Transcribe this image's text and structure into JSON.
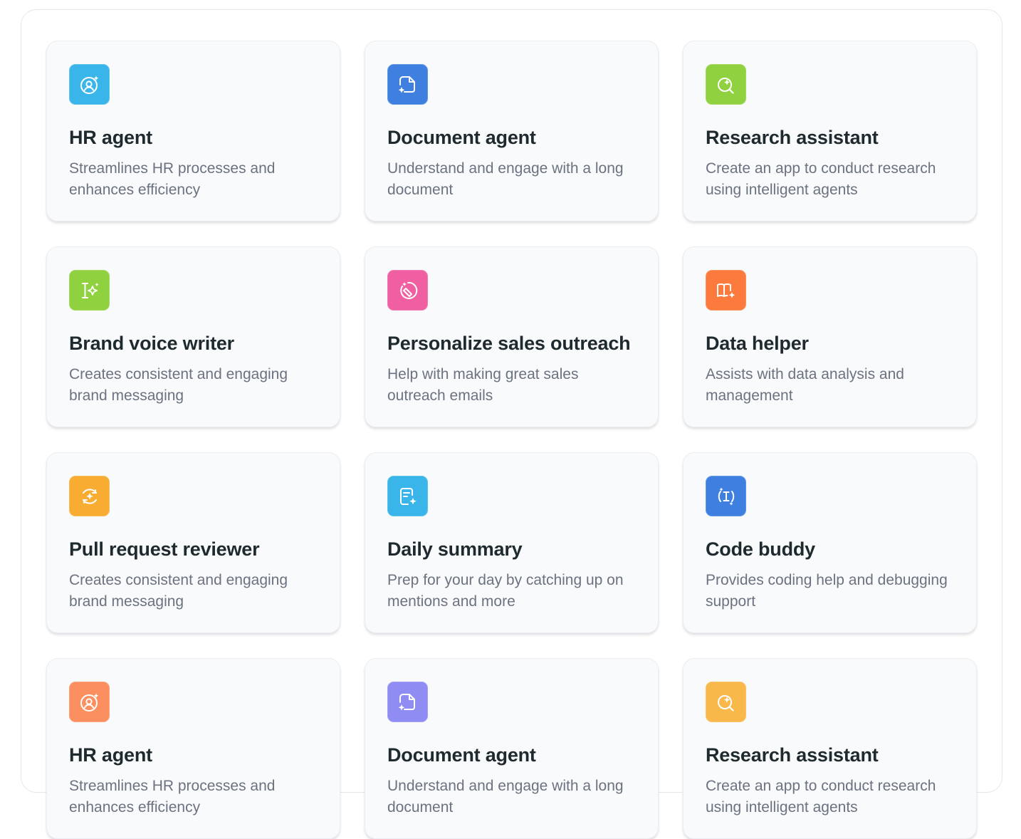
{
  "cards": [
    {
      "title": "HR agent",
      "desc": "Streamlines HR processes and enhances efficiency",
      "icon": "user-sparkle-icon",
      "color": "#3ab5ea"
    },
    {
      "title": "Document agent",
      "desc": "Understand and engage with a long document",
      "icon": "document-sparkle-icon",
      "color": "#3f7fe0"
    },
    {
      "title": "Research assistant",
      "desc": "Create an app to conduct research using intelligent agents",
      "icon": "search-sparkle-icon",
      "color": "#8fd13f"
    },
    {
      "title": "Brand voice writer",
      "desc": "Creates consistent and engaging brand messaging",
      "icon": "text-cursor-sparkle-icon",
      "color": "#8fd13f"
    },
    {
      "title": "Personalize sales outreach",
      "desc": "Help with making great sales outreach emails",
      "icon": "pen-sparkle-icon",
      "color": "#ef5fa2"
    },
    {
      "title": "Data helper",
      "desc": "Assists with data analysis and management",
      "icon": "book-sparkle-icon",
      "color": "#fb7a3c"
    },
    {
      "title": "Pull request reviewer",
      "desc": "Creates consistent and engaging brand messaging",
      "icon": "circle-sparkle-icon",
      "color": "#f8ac32"
    },
    {
      "title": "Daily summary",
      "desc": " Prep for your day by catching up on mentions and more",
      "icon": "note-sparkle-icon",
      "color": "#3ab5ea"
    },
    {
      "title": "Code buddy",
      "desc": "Provides coding help and debugging support",
      "icon": "code-cursor-icon",
      "color": "#3f7fe0"
    },
    {
      "title": "HR agent",
      "desc": "Streamlines HR processes and enhances efficiency",
      "icon": "user-sparkle-icon",
      "color": "#fb8f5f"
    },
    {
      "title": "Document agent",
      "desc": "Understand and engage with a long document",
      "icon": "document-sparkle-icon",
      "color": "#8f8cf3"
    },
    {
      "title": "Research assistant",
      "desc": "Create an app to conduct research using intelligent agents",
      "icon": "search-sparkle-icon",
      "color": "#f8b84a"
    }
  ]
}
